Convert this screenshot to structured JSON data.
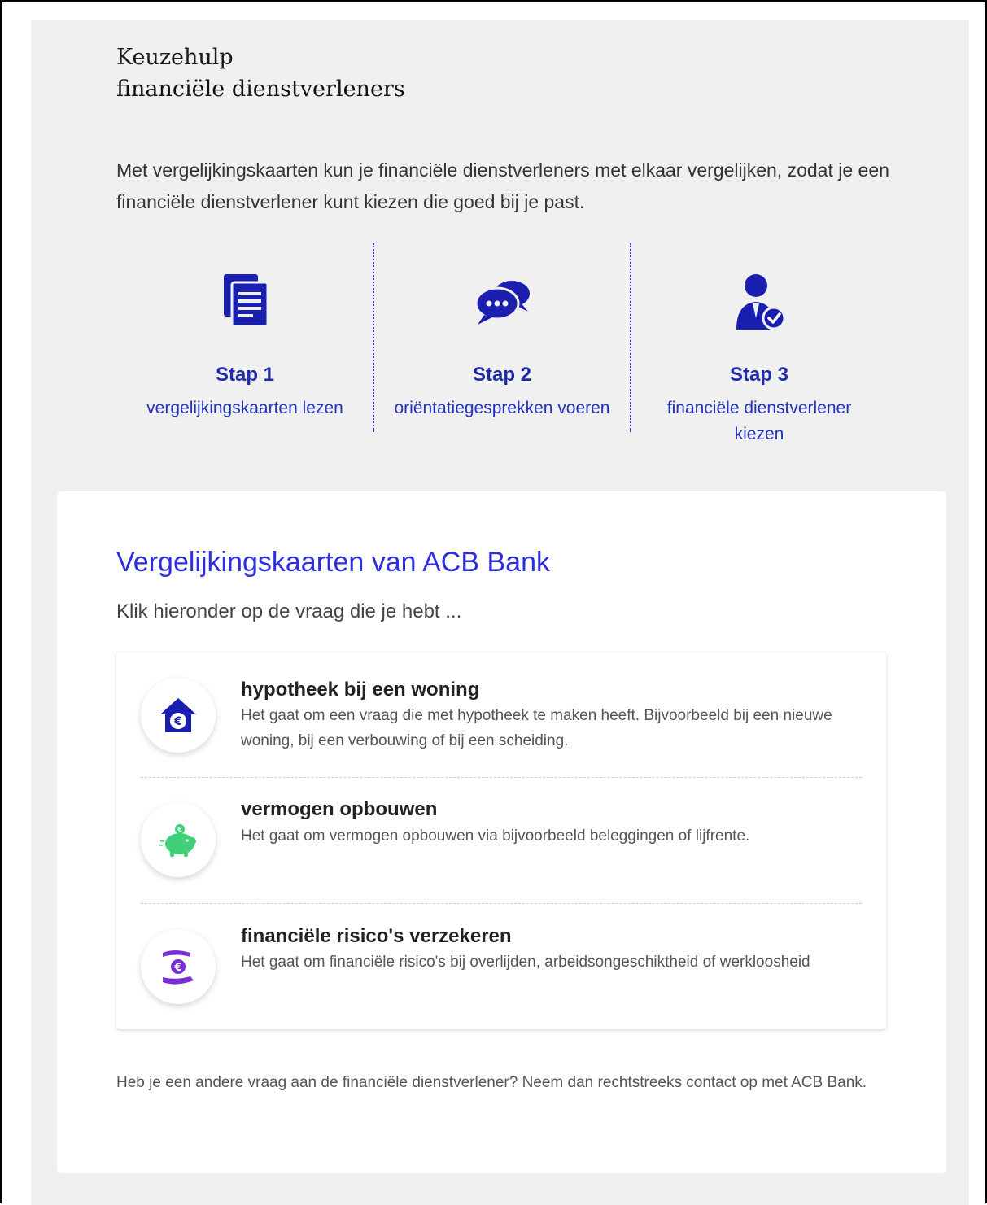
{
  "header": {
    "kicker": "Keuzehulp",
    "title": "financiële dienstverleners",
    "intro": "Met vergelijkingskaarten kun je financiële dienstverleners met elkaar vergelijken, zodat je een financiële dienstverlener kunt kiezen die goed bij je past."
  },
  "steps": [
    {
      "title": "Stap 1",
      "text": "vergelijkingskaarten lezen",
      "icon": "documents-icon"
    },
    {
      "title": "Stap 2",
      "text": "oriëntatiegesprekken voeren",
      "icon": "chat-bubbles-icon"
    },
    {
      "title": "Stap 3",
      "text": "financiële dienstverlener kiezen",
      "icon": "person-check-icon"
    }
  ],
  "card": {
    "title": "Vergelijkingskaarten van ACB Bank",
    "subtitle": "Klik hieronder op de vraag die je hebt ...",
    "items": [
      {
        "title": "hypotheek bij een woning",
        "desc": "Het gaat om een vraag die met hypotheek te maken heeft. Bijvoorbeeld bij een nieuwe woning, bij een verbouwing of bij een scheiding.",
        "icon": "house-euro-icon"
      },
      {
        "title": "vermogen opbouwen",
        "desc": "Het gaat om vermogen opbouwen via bijvoorbeeld beleggingen of lijfrente.",
        "icon": "piggy-bank-icon"
      },
      {
        "title": "financiële risico's verzekeren",
        "desc": "Het gaat om financiële risico's bij overlijden, arbeidsongeschiktheid of werkloosheid",
        "icon": "hands-euro-icon"
      }
    ],
    "footer": "Heb je een andere vraag aan de financiële dienstverlener? Neem dan rechtstreeks contact op met ACB Bank."
  },
  "colors": {
    "accent": "#1e2aa8",
    "title_blue": "#2d2ee0",
    "piggy_green": "#3ed17a",
    "hands_purple": "#7a2fd6",
    "background": "#f0f0f0"
  }
}
